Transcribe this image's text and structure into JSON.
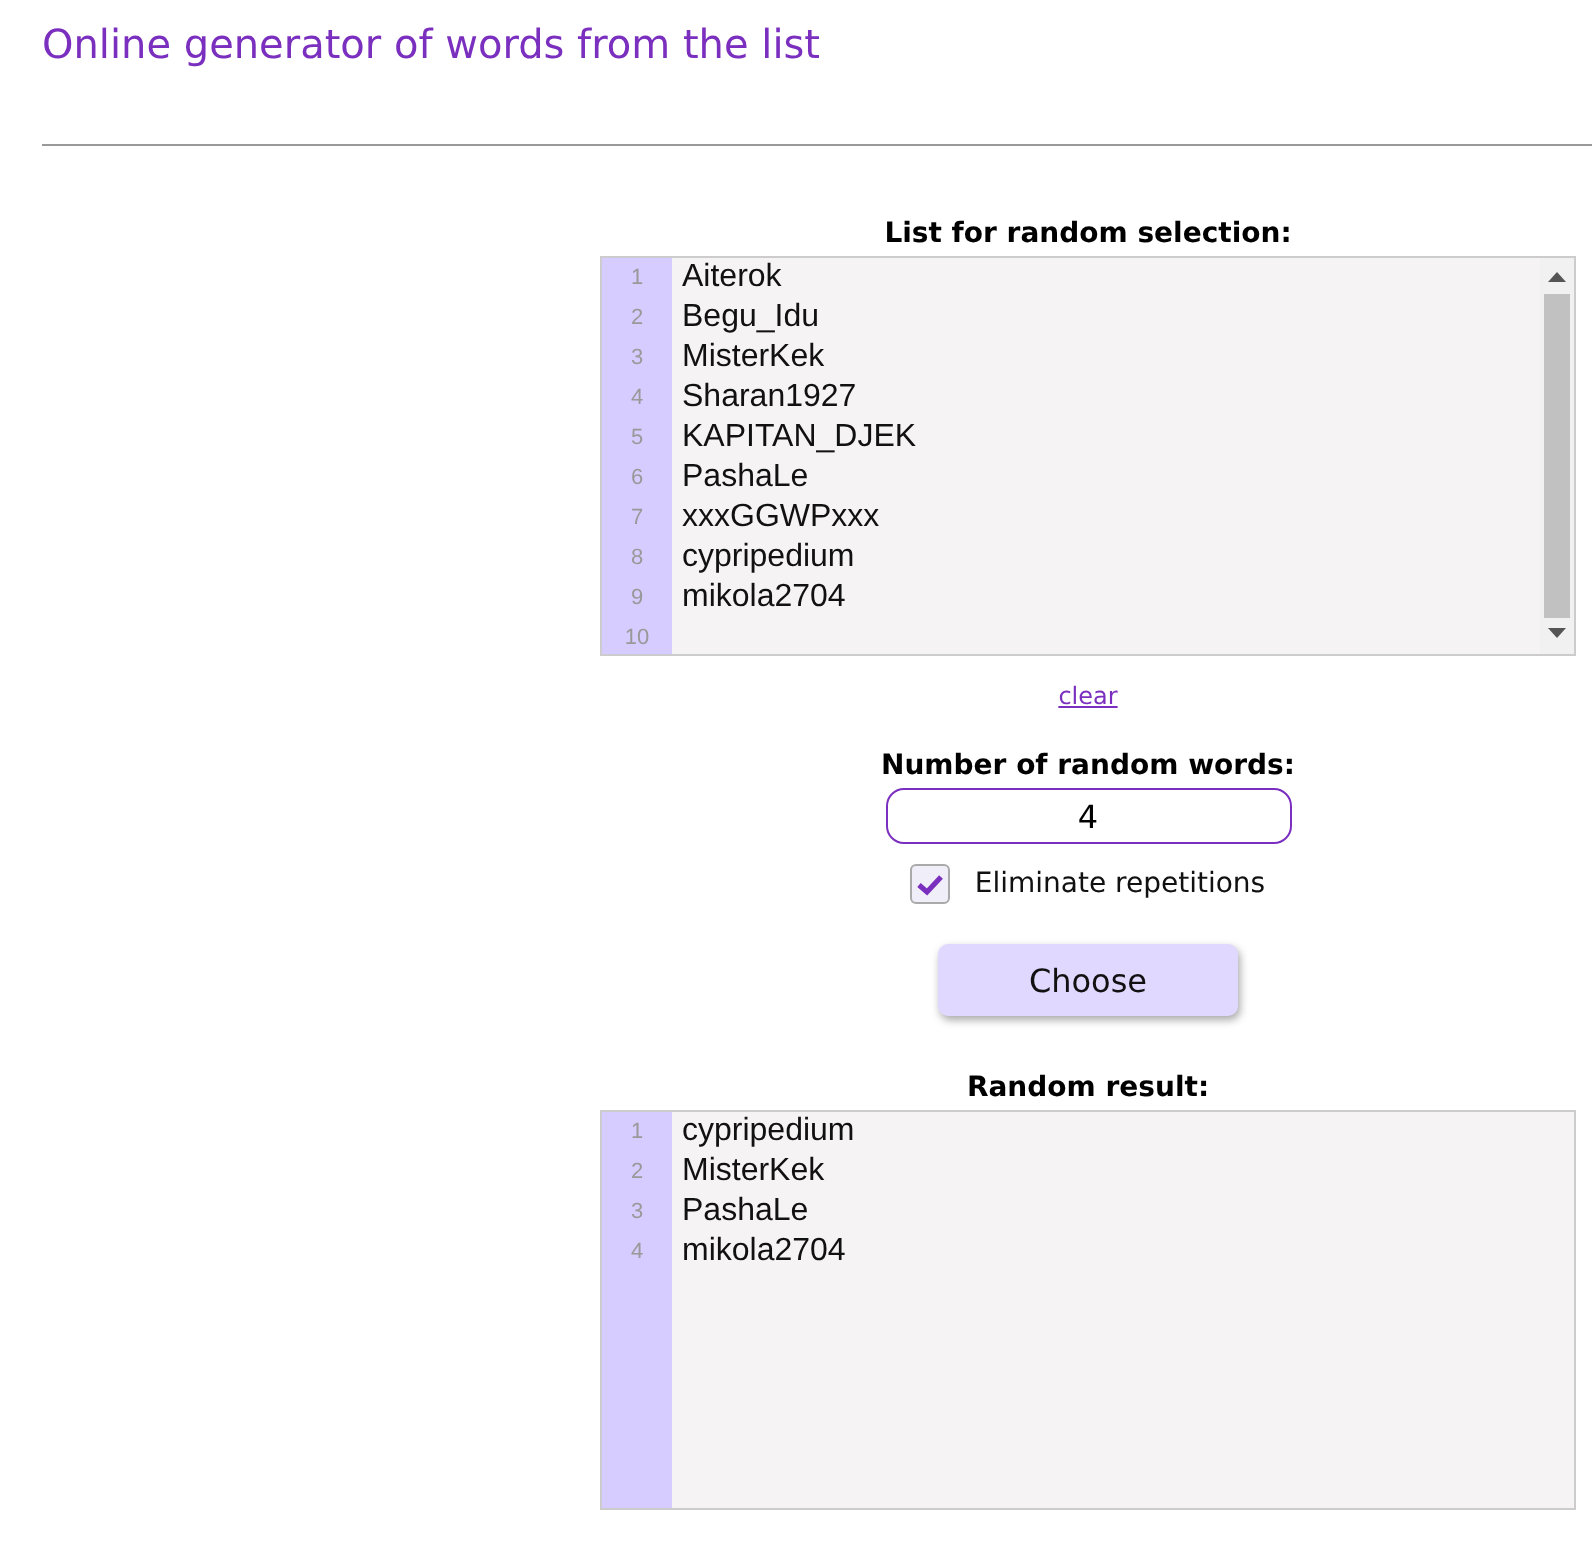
{
  "title": "Online generator of words from the list",
  "list_editor": {
    "label": "List for random selection:",
    "line_numbers": [
      "1",
      "2",
      "3",
      "4",
      "5",
      "6",
      "7",
      "8",
      "9",
      "10"
    ],
    "lines": [
      "Aiterok",
      "Begu_Idu",
      "MisterKek",
      "Sharan1927",
      "KAPITAN_DJEK",
      "PashaLe",
      "xxxGGWPxxx",
      "cypripedium",
      "mikola2704"
    ]
  },
  "clear_link": "clear",
  "count": {
    "label": "Number of random words:",
    "value": "4"
  },
  "eliminate_repetitions": {
    "label": "Eliminate repetitions",
    "checked": true
  },
  "choose_button": "Choose",
  "result_editor": {
    "label": "Random result:",
    "line_numbers": [
      "1",
      "2",
      "3",
      "4"
    ],
    "lines": [
      "cypripedium",
      "MisterKek",
      "PashaLe",
      "mikola2704"
    ]
  }
}
